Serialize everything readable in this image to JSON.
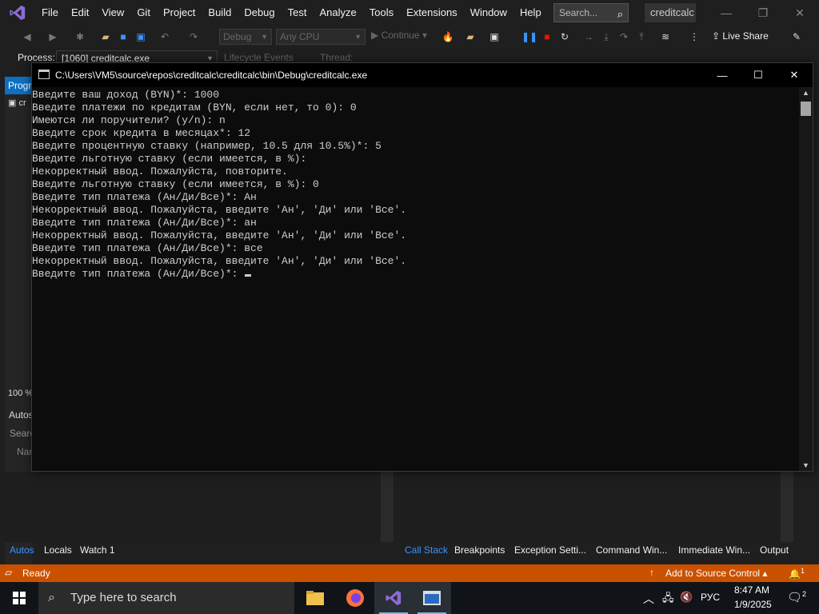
{
  "vs": {
    "menu": [
      "File",
      "Edit",
      "View",
      "Git",
      "Project",
      "Build",
      "Debug",
      "Test",
      "Analyze",
      "Tools",
      "Extensions",
      "Window",
      "Help"
    ],
    "search_placeholder": "Search...",
    "solution_name": "creditcalc",
    "toolbar": {
      "config": "Debug",
      "platform": "Any CPU",
      "continue": "Continue",
      "live_share": "Live Share"
    },
    "location": {
      "process_label": "Process:",
      "process_value": "[1060] creditcalc.exe",
      "lifecycle": "Lifecycle Events",
      "thread": "Thread:"
    },
    "left": {
      "programs_tab": "Progr",
      "item": "cr",
      "zoom": "100 %",
      "autos_header": "Autos",
      "search": "Searc",
      "name": "Nar"
    },
    "bottom_tabs_left": [
      {
        "label": "Autos",
        "active": true
      },
      {
        "label": "Locals",
        "active": false
      },
      {
        "label": "Watch 1",
        "active": false
      }
    ],
    "bottom_tabs_right": [
      {
        "label": "Call Stack",
        "active": true
      },
      {
        "label": "Breakpoints",
        "active": false
      },
      {
        "label": "Exception Setti...",
        "active": false
      },
      {
        "label": "Command Win...",
        "active": false
      },
      {
        "label": "Immediate Win...",
        "active": false
      },
      {
        "label": "Output",
        "active": false
      }
    ],
    "status": {
      "ready": "Ready",
      "source_control": "Add to Source Control",
      "notifications": "1"
    }
  },
  "console": {
    "title": "C:\\Users\\VM5\\source\\repos\\creditcalc\\creditcalc\\bin\\Debug\\creditcalc.exe",
    "lines": [
      "Введите ваш доход (BYN)*: 1000",
      "Введите платежи по кредитам (BYN, если нет, то 0): 0",
      "Имеются ли поручители? (y/n): n",
      "Введите срок кредита в месяцах*: 12",
      "Введите процентную ставку (например, 10.5 для 10.5%)*: 5",
      "Введите льготную ставку (если имеется, в %):",
      "Некорректный ввод. Пожалуйста, повторите.",
      "Введите льготную ставку (если имеется, в %): 0",
      "Введите тип платежа (Ан/Ди/Все)*: Ан",
      "Некорректный ввод. Пожалуйста, введите 'Ан', 'Ди' или 'Все'.",
      "Введите тип платежа (Ан/Ди/Все)*: ан",
      "Некорректный ввод. Пожалуйста, введите 'Ан', 'Ди' или 'Все'.",
      "Введите тип платежа (Ан/Ди/Все)*: все",
      "Некорректный ввод. Пожалуйста, введите 'Ан', 'Ди' или 'Все'.",
      "Введите тип платежа (Ан/Ди/Все)*: "
    ]
  },
  "taskbar": {
    "search_placeholder": "Type here to search",
    "language": "РУС",
    "time": "8:47 AM",
    "date": "1/9/2025",
    "notification_count": "2"
  },
  "colors": {
    "accent": "#0e70c0",
    "status_bar": "#ca5100",
    "vs_purple": "#8c6bd6"
  }
}
